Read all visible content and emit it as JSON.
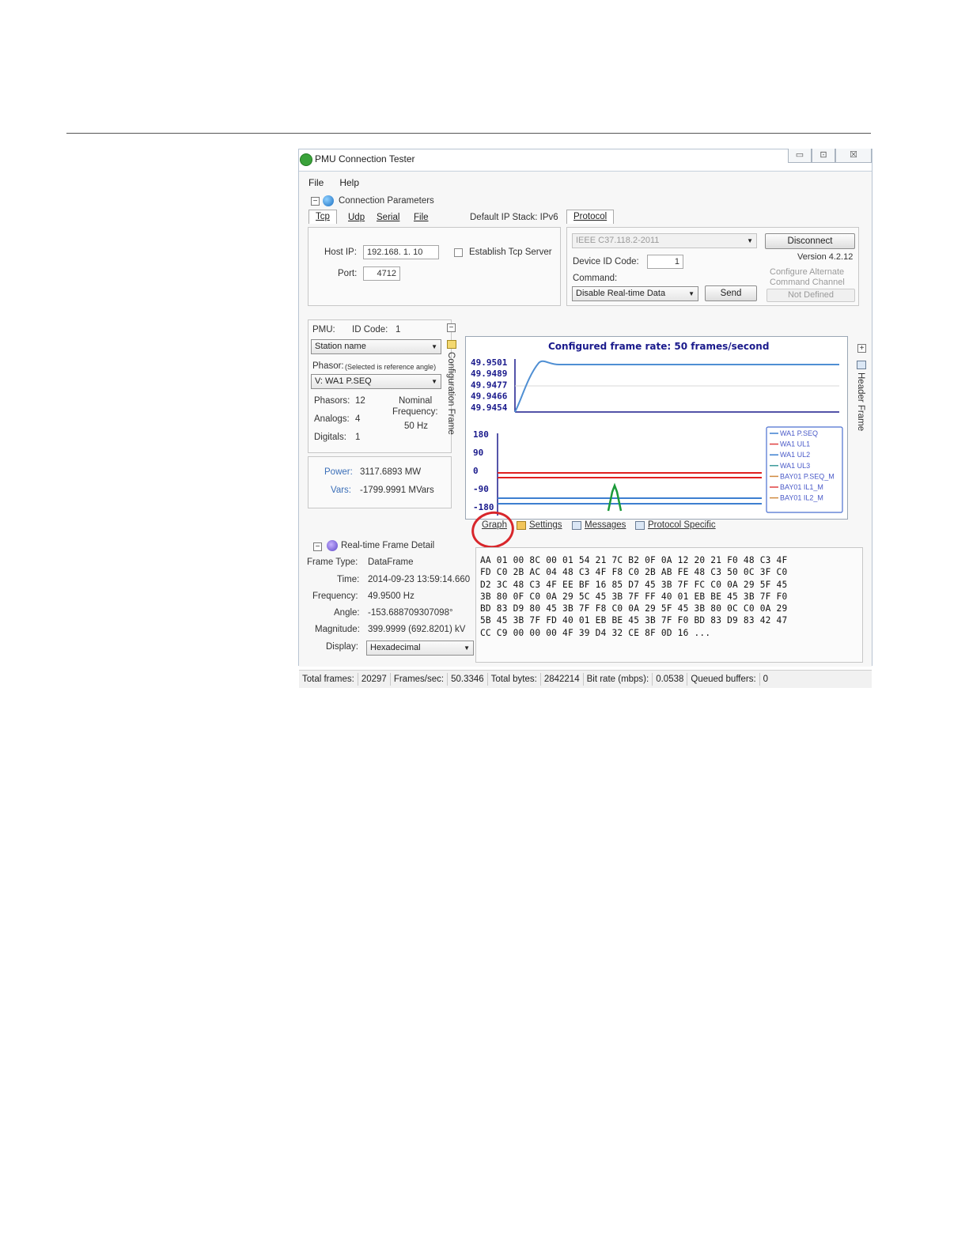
{
  "window": {
    "title": "PMU Connection Tester",
    "controls": {
      "minimize": "▭",
      "maximize": "⊡",
      "close": "☒"
    }
  },
  "menu": {
    "file": "File",
    "help": "Help"
  },
  "connection": {
    "section_title": "Connection Parameters",
    "tabs": {
      "tcp": "Tcp",
      "udp": "Udp",
      "serial": "Serial",
      "file": "File"
    },
    "default_ip_stack": "Default IP Stack: IPv6",
    "host_ip_label": "Host IP:",
    "host_ip_value": "192.168.   1.  10",
    "port_label": "Port:",
    "port_value": "4712",
    "establish_server_label": "Establish Tcp Server"
  },
  "protocol": {
    "tab_label": "Protocol",
    "protocol_value": "IEEE C37.118.2-2011",
    "disconnect_label": "Disconnect",
    "version": "Version 4.2.12",
    "device_id_label": "Device ID Code:",
    "device_id_value": "1",
    "configure_alt": "Configure Alternate",
    "command_channel": "Command Channel",
    "command_label": "Command:",
    "command_value": "Disable Real-time Data",
    "send_label": "Send",
    "not_defined_label": "Not Defined"
  },
  "pmu": {
    "pmu_label": "PMU:",
    "id_code_label": "ID Code:",
    "id_code_value": "1",
    "station_value": "Station name",
    "phasor_label": "Phasor:",
    "phasor_note": "(Selected is reference angle)",
    "phasor_value": "V: WA1 P.SEQ",
    "phasors_label": "Phasors:",
    "phasors_value": "12",
    "analogs_label": "Analogs:",
    "analogs_value": "4",
    "digitals_label": "Digitals:",
    "digitals_value": "1",
    "nominal_label": "Nominal",
    "frequency_label": "Frequency:",
    "nominal_value": "50 Hz",
    "power_label": "Power:",
    "power_value": "3117.6893 MW",
    "vars_label": "Vars:",
    "vars_value": "-1799.9991 MVars",
    "config_frame_label": "Configuration Frame"
  },
  "graph": {
    "title": "Configured frame rate: 50 frames/second",
    "freq_ticks": [
      "49.9501",
      "49.9489",
      "49.9477",
      "49.9466",
      "49.9454"
    ],
    "angle_ticks": [
      "180",
      "90",
      "0",
      "-90",
      "-180"
    ],
    "legend": [
      "WA1 P.SEQ",
      "WA1 UL1",
      "WA1 UL2",
      "WA1 UL3",
      "BAY01 P.SEQ_M",
      "BAY01 IL1_M",
      "BAY01 IL2_M"
    ],
    "colors": {
      "freq_line": "#4f8fd3",
      "red_lines": "#e02020",
      "blue_lines": "#3d7fd0",
      "green_spike": "#1b9a3a",
      "axis_text": "#1a1a8c"
    }
  },
  "bottom_tabs": {
    "graph": "Graph",
    "settings": "Settings",
    "messages": "Messages",
    "protocol_specific": "Protocol Specific"
  },
  "header_frame_label": "Header Frame",
  "frame_detail": {
    "section_title": "Real-time Frame Detail",
    "frame_type_label": "Frame Type:",
    "frame_type_value": "DataFrame",
    "time_label": "Time:",
    "time_value": "2014-09-23 13:59:14.660",
    "frequency_label": "Frequency:",
    "frequency_value": "49.9500 Hz",
    "angle_label": "Angle:",
    "angle_value": "-153.688709307098°",
    "magnitude_label": "Magnitude:",
    "magnitude_value": "399.9999 (692.8201) kV",
    "display_label": "Display:",
    "display_value": "Hexadecimal",
    "hex_lines": [
      "AA 01 00 8C 00 01 54 21 7C B2 0F 0A 12 20 21 F0 48 C3 4F",
      "FD C0 2B AC 04 48 C3 4F F8 C0 2B AB FE 48 C3 50 0C 3F C0",
      "D2 3C 48 C3 4F EE BF 16 85 D7 45 3B 7F FC C0 0A 29 5F 45",
      "3B 80 0F C0 0A 29 5C 45 3B 7F FF 40 01 EB BE 45 3B 7F F0",
      "BD 83 D9 80 45 3B 7F F8 C0 0A 29 5F 45 3B 80 0C C0 0A 29",
      "5B 45 3B 7F FD 40 01 EB BE 45 3B 7F F0 BD 83 D9 83 42 47",
      "CC C9 00 00 00 4F 39 D4 32 CE 8F 0D 16 ..."
    ]
  },
  "status": {
    "total_frames_label": "Total frames:",
    "total_frames_value": "20297",
    "frames_sec_label": "Frames/sec:",
    "frames_sec_value": "50.3346",
    "total_bytes_label": "Total bytes:",
    "total_bytes_value": "2842214",
    "bit_rate_label": "Bit rate (mbps):",
    "bit_rate_value": "0.0538",
    "queued_label": "Queued buffers:",
    "queued_value": "0"
  }
}
